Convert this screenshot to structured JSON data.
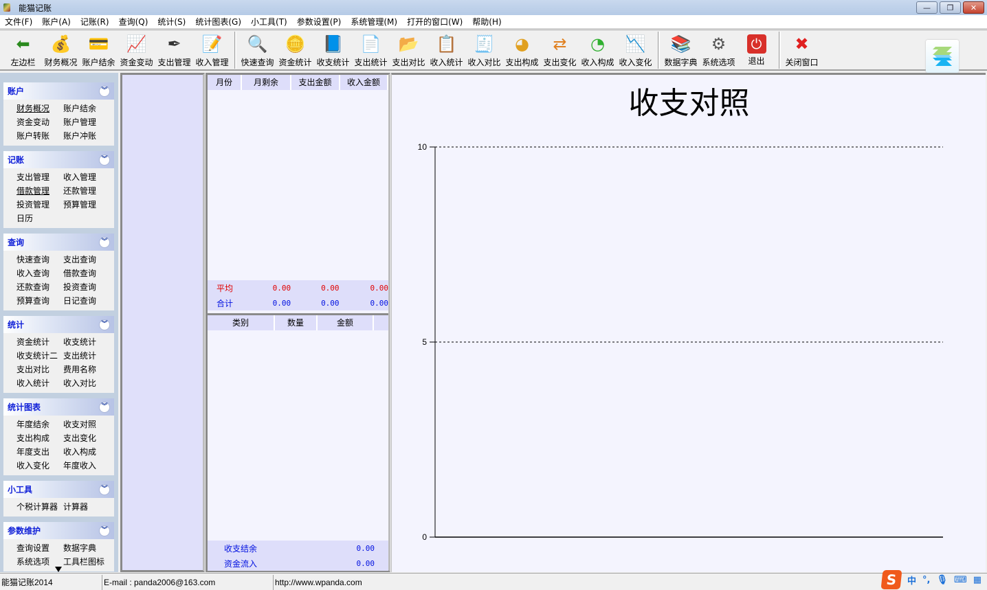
{
  "window": {
    "title": "能猫记账",
    "controls": {
      "minimize": "—",
      "restore": "❐",
      "close": "✕"
    }
  },
  "menu": [
    "文件(F)",
    "账户(A)",
    "记账(R)",
    "查询(Q)",
    "统计(S)",
    "统计图表(G)",
    "小工具(T)",
    "参数设置(P)",
    "系统管理(M)",
    "打开的窗口(W)",
    "帮助(H)"
  ],
  "toolbar": {
    "groups": [
      [
        {
          "label": "左边栏",
          "icon": "arrow-left-icon",
          "glyph": "⬅",
          "color": "#2a8a1e"
        },
        {
          "label": "财务概况",
          "icon": "finance-overview-icon",
          "glyph": "💰",
          "color": "#d9a420"
        },
        {
          "label": "账户结余",
          "icon": "wallet-card-icon",
          "glyph": "💳",
          "color": "#e0b030"
        },
        {
          "label": "资金变动",
          "icon": "growth-chart-icon",
          "glyph": "📈",
          "color": "#3a9a20"
        },
        {
          "label": "支出管理",
          "icon": "fountain-pen-icon",
          "glyph": "✒",
          "color": "#333333"
        },
        {
          "label": "收入管理",
          "icon": "notepad-pencil-icon",
          "glyph": "📝",
          "color": "#8a5ab0"
        }
      ],
      [
        {
          "label": "快速查询",
          "icon": "magnifier-icon",
          "glyph": "🔍",
          "color": "#3a7ac8"
        },
        {
          "label": "资金统计",
          "icon": "coins-icon",
          "glyph": "🪙",
          "color": "#d9a420"
        },
        {
          "label": "收支统计",
          "icon": "address-book-icon",
          "glyph": "📘",
          "color": "#2a6ad0"
        },
        {
          "label": "支出统计",
          "icon": "document-icon",
          "glyph": "📄",
          "color": "#c84030"
        },
        {
          "label": "支出对比",
          "icon": "folder-document-icon",
          "glyph": "📂",
          "color": "#d8b060"
        },
        {
          "label": "收入统计",
          "icon": "edit-document-icon",
          "glyph": "📋",
          "color": "#5a7ab0"
        },
        {
          "label": "收入对比",
          "icon": "receipt-icon",
          "glyph": "🧾",
          "color": "#a06050"
        },
        {
          "label": "支出构成",
          "icon": "pie-chart-icon",
          "glyph": "◕",
          "color": "#e0a020"
        },
        {
          "label": "支出变化",
          "icon": "direction-arrows-icon",
          "glyph": "⇄",
          "color": "#e08020"
        },
        {
          "label": "收入构成",
          "icon": "pie-3d-icon",
          "glyph": "◔",
          "color": "#30b030"
        },
        {
          "label": "收入变化",
          "icon": "line-chart-coins-icon",
          "glyph": "📉",
          "color": "#5080c0"
        }
      ],
      [
        {
          "label": "数据字典",
          "icon": "books-icon",
          "glyph": "📚",
          "color": "#e09020"
        },
        {
          "label": "系统选项",
          "icon": "gear-icon",
          "glyph": "⚙",
          "color": "#555555"
        },
        {
          "label": "退出",
          "icon": "power-icon",
          "glyph": "⏻",
          "color": "#ffffff"
        }
      ],
      [
        {
          "label": "关闭窗口",
          "icon": "close-x-icon",
          "glyph": "✖",
          "color": "#e02020"
        }
      ]
    ]
  },
  "sidebar": {
    "groups": [
      {
        "title": "账户",
        "items": [
          "财务概况",
          "账户结余",
          "资金变动",
          "账户管理",
          "账户转账",
          "账户冲账"
        ],
        "underlined": [
          0
        ]
      },
      {
        "title": "记账",
        "items": [
          "支出管理",
          "收入管理",
          "借款管理",
          "还款管理",
          "投资管理",
          "预算管理",
          "日历"
        ],
        "underlined": [
          2
        ]
      },
      {
        "title": "查询",
        "items": [
          "快速查询",
          "支出查询",
          "收入查询",
          "借款查询",
          "还款查询",
          "投资查询",
          "预算查询",
          "日记查询"
        ],
        "underlined": []
      },
      {
        "title": "统计",
        "items": [
          "资金统计",
          "收支统计",
          "收支统计二",
          "支出统计",
          "支出对比",
          "费用名称",
          "收入统计",
          "收入对比"
        ],
        "underlined": []
      },
      {
        "title": "统计图表",
        "items": [
          "年度结余",
          "收支对照",
          "支出构成",
          "支出变化",
          "年度支出",
          "收入构成",
          "收入变化",
          "年度收入"
        ],
        "underlined": []
      },
      {
        "title": "小工具",
        "items": [
          "个税计算器",
          "计算器"
        ],
        "underlined": []
      },
      {
        "title": "参数维护",
        "items": [
          "查询设置",
          "数据字典",
          "系统选项",
          "工具栏图标"
        ],
        "underlined": []
      }
    ]
  },
  "monthly_table": {
    "columns": [
      "月份",
      "月剩余",
      "支出金额",
      "收入金额"
    ],
    "rows": [],
    "average": {
      "label": "平均",
      "values": [
        "0.00",
        "0.00",
        "0.00"
      ]
    },
    "total": {
      "label": "合计",
      "values": [
        "0.00",
        "0.00",
        "0.00"
      ]
    }
  },
  "category_table": {
    "columns": [
      "类别",
      "数量",
      "金额"
    ],
    "rows": [],
    "summary": [
      {
        "label": "收支结余",
        "value": "0.00"
      },
      {
        "label": "资金流入",
        "value": "0.00"
      }
    ]
  },
  "chart_data": {
    "type": "bar",
    "title": "收支对照",
    "categories": [],
    "series": [],
    "xlabel": "",
    "ylabel": "",
    "ylim": [
      0,
      10
    ],
    "yticks": [
      0,
      5,
      10
    ],
    "grid": true,
    "legend": "none"
  },
  "statusbar": {
    "app": "能猫记账2014",
    "email": "E-mail : panda2006@163.com",
    "website": "http://www.wpanda.com"
  },
  "ime": {
    "logo": "S",
    "mode": "中",
    "punct": "°,",
    "mic": "🎙",
    "keyboard": "⌨",
    "grid": "▦"
  }
}
